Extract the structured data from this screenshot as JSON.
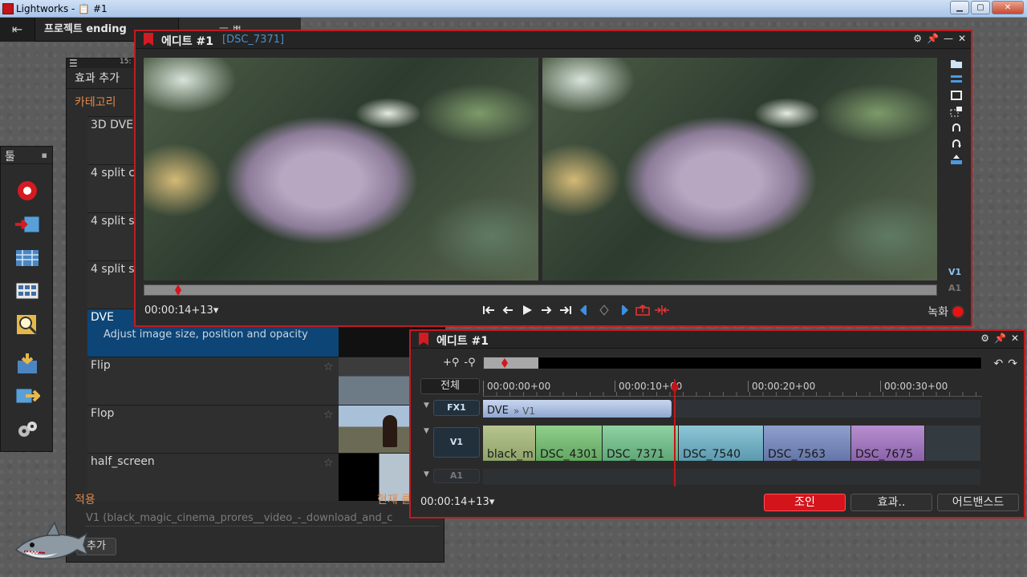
{
  "os": {
    "title": "Lightworks - 📋 #1"
  },
  "project": {
    "name": "프로젝트 ending",
    "second_tab": "ㅡ ㅃ"
  },
  "fx_panel": {
    "menu_icon": "hamburger-icon",
    "time": "15:",
    "header": "효과 추가",
    "category_label": "카테고리",
    "items": [
      {
        "name": "3D DVE",
        "star": ""
      },
      {
        "name": "4 split c",
        "star": ""
      },
      {
        "name": "4 split s",
        "star": ""
      },
      {
        "name": "4 split s",
        "star": ""
      },
      {
        "name": "DVE",
        "desc": "Adjust image size, position and opacity"
      },
      {
        "name": "Flip",
        "star": "☆"
      },
      {
        "name": "Flop",
        "star": "☆"
      },
      {
        "name": "half_screen",
        "star": "☆"
      }
    ],
    "apply_label": "적용",
    "current_label": "현재 클",
    "apply_value": "V1 (black_magic_cinema_prores__video_-_download_and_c",
    "add_button": "추가"
  },
  "tools_panel": {
    "title": "툴",
    "pin": "▪",
    "tools": [
      "record-icon",
      "import-icon",
      "timeline-icon",
      "bins-icon",
      "search-icon",
      "export-icon",
      "send-icon",
      "settings-icon"
    ]
  },
  "viewer": {
    "title": "에디트 #1",
    "clip": "[DSC_7371]",
    "timecode": "00:00:14+13▾",
    "record_label": "녹화",
    "track_v1": "V1",
    "track_a1": "A1",
    "window_controls": [
      "⚙",
      "📌",
      "—",
      "✕"
    ]
  },
  "timeline": {
    "title": "에디트 #1",
    "zoom_in": "+⚲",
    "zoom_out": "-⚲",
    "all_button": "전체",
    "ruler_ticks": [
      "00:00:00+00",
      "00:00:10+00",
      "00:00:20+00",
      "00:00:30+00"
    ],
    "tracks": {
      "fx1": {
        "name": "FX1",
        "clip": "DVE",
        "clip_sub": "» V1"
      },
      "v1": {
        "name": "V1",
        "clips": [
          "black_m",
          "DSC_4301",
          "DSC_7371",
          "DSC_7540",
          "DSC_7563",
          "DSC_7675"
        ]
      },
      "a1": {
        "name": "A1"
      }
    },
    "timecode": "00:00:14+13▾",
    "join_button": "조인",
    "effects_button": "효과..",
    "advanced_button": "어드밴스드",
    "undo": "↶",
    "redo": "↷"
  },
  "colors": {
    "accent_red": "#c01b22",
    "category_orange": "#e2874a",
    "selection_blue": "#0d4576"
  }
}
